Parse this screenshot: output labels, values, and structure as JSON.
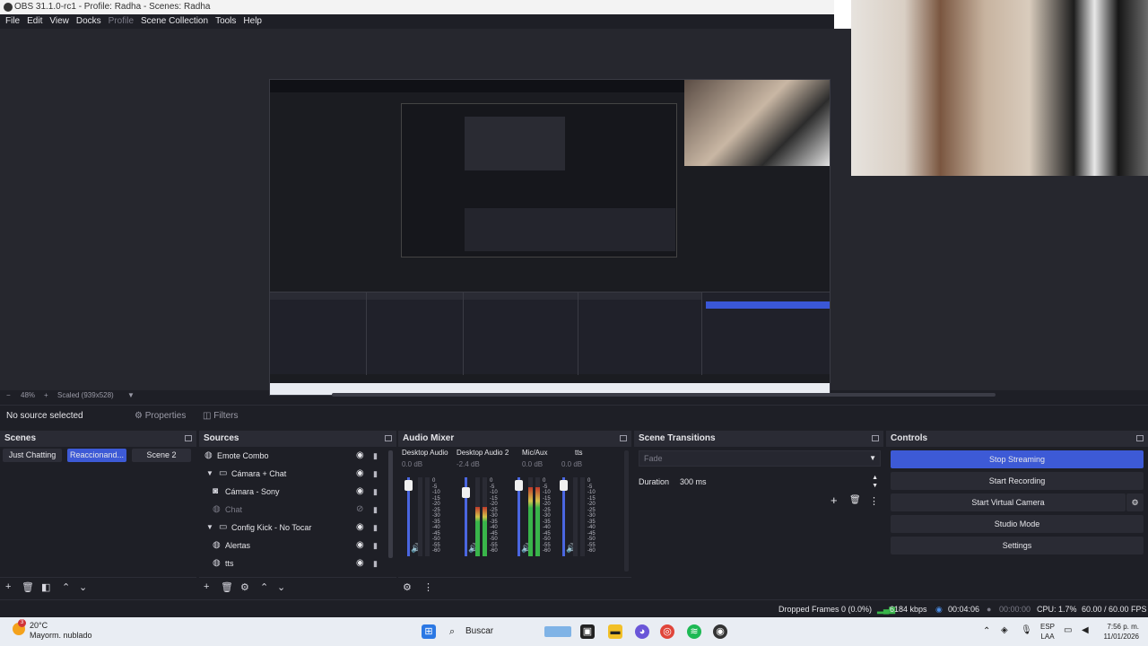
{
  "window": {
    "title": "OBS 31.1.0-rc1 - Profile: Radha - Scenes: Radha"
  },
  "menu": {
    "items": [
      "File",
      "Edit",
      "View",
      "Docks",
      "Profile",
      "Scene Collection",
      "Tools",
      "Help"
    ]
  },
  "zoom": {
    "minus": "−",
    "level": "48%",
    "plus": "+",
    "mode": "Scaled (939x528)"
  },
  "context": {
    "no_source": "No source selected",
    "properties": "Properties",
    "filters": "Filters"
  },
  "scenes": {
    "title": "Scenes",
    "items": [
      {
        "label": "Just Chatting",
        "active": false
      },
      {
        "label": "Reaccionand...",
        "active": true
      },
      {
        "label": "Scene 2",
        "active": false
      }
    ]
  },
  "sources": {
    "title": "Sources",
    "items": [
      {
        "label": "Emote Combo",
        "icon": "globe-icon",
        "visible": true
      },
      {
        "label": "Cámara + Chat",
        "icon": "folder-icon",
        "visible": true
      },
      {
        "label": "Cámara - Sony",
        "icon": "camera-icon",
        "visible": true
      },
      {
        "label": "Chat",
        "icon": "globe-icon",
        "visible": false
      },
      {
        "label": "Config Kick - No Tocar",
        "icon": "folder-icon",
        "visible": true
      },
      {
        "label": "Alertas",
        "icon": "globe-icon",
        "visible": true
      },
      {
        "label": "tts",
        "icon": "globe-icon",
        "visible": true
      }
    ]
  },
  "mixer": {
    "title": "Audio Mixer",
    "scale": [
      "0",
      "-5",
      "-10",
      "-15",
      "-20",
      "-25",
      "-30",
      "-35",
      "-40",
      "-45",
      "-50",
      "-55",
      "-60"
    ],
    "channels": [
      {
        "name": "Desktop Audio",
        "db": "0.0 dB",
        "level": 0.0,
        "fader": 0.96
      },
      {
        "name": "Desktop Audio 2",
        "db": "-2.4 dB",
        "level": 0.62,
        "fader": 0.86
      },
      {
        "name": "Mic/Aux",
        "db": "0.0 dB",
        "level": 0.88,
        "fader": 0.96
      },
      {
        "name": "tts",
        "db": "0.0 dB",
        "level": 0.0,
        "fader": 0.96
      }
    ]
  },
  "transitions": {
    "title": "Scene Transitions",
    "selected": "Fade",
    "duration_label": "Duration",
    "duration_value": "300 ms"
  },
  "controls": {
    "title": "Controls",
    "stop_streaming": "Stop Streaming",
    "start_recording": "Start Recording",
    "start_virtual_camera": "Start Virtual Camera",
    "studio_mode": "Studio Mode",
    "settings": "Settings"
  },
  "status": {
    "dropped_frames": "Dropped Frames 0 (0.0%)",
    "bitrate": "6184 kbps",
    "stream_time": "00:04:06",
    "record_time": "00:00:00",
    "cpu": "CPU: 1.7%",
    "fps": "60.00 / 60.00 FPS"
  },
  "taskbar": {
    "weather_temp": "20°C",
    "weather_desc": "Mayorm. nublado",
    "weather_badge": "3",
    "search_placeholder": "Buscar",
    "lang_top": "ESP",
    "lang_bottom": "LAA",
    "time": "7:56 p. m.",
    "date": "11/01/2026"
  },
  "colors": {
    "accent": "#3d5ad6",
    "panel": "#1e1f26",
    "header": "#2a2b34"
  }
}
